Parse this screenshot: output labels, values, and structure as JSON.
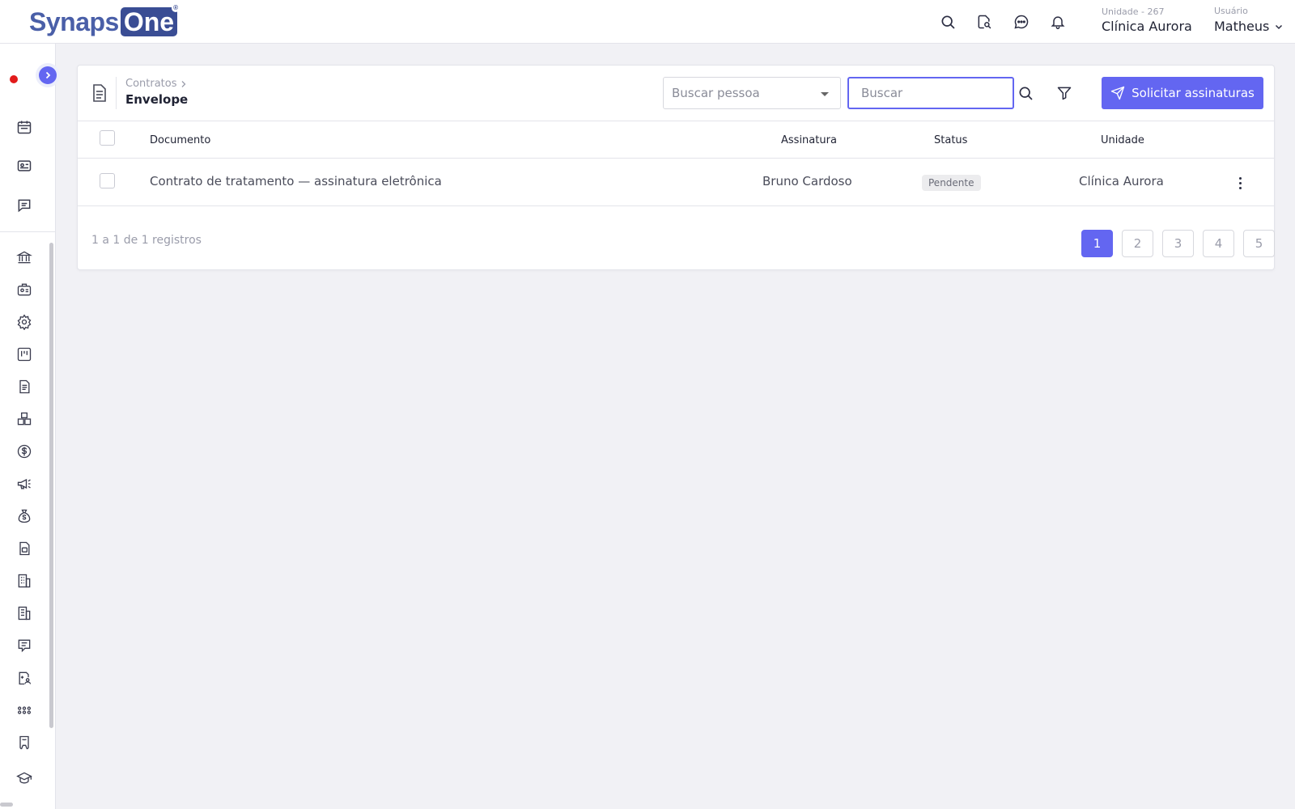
{
  "brand": {
    "name_part1": "Synaps",
    "name_part2": "One",
    "reg_mark": "®",
    "primary_color": "#6366f1"
  },
  "topbar": {
    "icons": [
      "search-icon",
      "document-search-icon",
      "chat-icon",
      "bell-icon"
    ],
    "unit_label": "Unidade - 267",
    "unit_name": "Clínica Aurora",
    "user_label": "Usuário",
    "user_name": "Matheus"
  },
  "sidebar": {
    "top_icons": [
      "calendar-icon",
      "id-card-icon",
      "message-icon"
    ],
    "menu_icons": [
      "bank-icon",
      "briefcase-icon",
      "gear-icon",
      "kanban-icon",
      "document-icon",
      "boxes-icon",
      "dollar-icon",
      "megaphone-icon",
      "money-bag-icon",
      "report-icon",
      "building-icon",
      "building-alt-icon",
      "chat-list-icon",
      "clipboard-user-icon",
      "grid-dots-icon",
      "tooth-icon",
      "graduation-cap-icon"
    ]
  },
  "breadcrumb": {
    "parent": "Contratos",
    "current": "Envelope"
  },
  "filters": {
    "person_placeholder": "Buscar pessoa",
    "search_placeholder": "Buscar"
  },
  "actions": {
    "request_signatures": "Solicitar assinaturas"
  },
  "table": {
    "columns": [
      "Documento",
      "Assinatura",
      "Status",
      "Unidade"
    ],
    "rows": [
      {
        "documento": "Contrato de tratamento — assinatura eletrônica",
        "assinatura": "Bruno Cardoso",
        "status": "Pendente",
        "unidade": "Clínica Aurora"
      }
    ]
  },
  "pagination": {
    "summary": "1 a 1 de 1 registros",
    "pages": [
      "1",
      "2",
      "3",
      "4",
      "5"
    ],
    "current_page": "1"
  }
}
